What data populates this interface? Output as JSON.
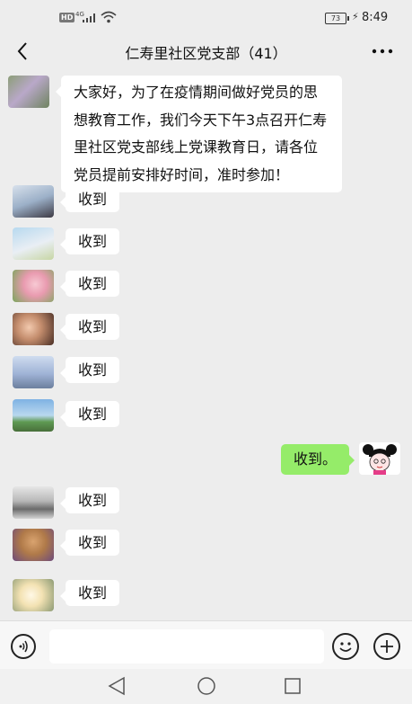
{
  "status_bar": {
    "hd": "HD",
    "network": "4G",
    "battery": "73",
    "time": "8:49"
  },
  "header": {
    "title": "仁寿里社区党支部（41）"
  },
  "messages": [
    {
      "text": "大家好，为了在疫情期间做好党员的思想教育工作，我们今天下午3点召开仁寿里社区党支部线上党课教育日，请各位党员提前安排好时间，准时参加！"
    },
    {
      "text": "收到"
    },
    {
      "text": "收到"
    },
    {
      "text": "收到"
    },
    {
      "text": "收到"
    },
    {
      "text": "收到"
    },
    {
      "text": "收到"
    },
    {
      "text": "收到。"
    },
    {
      "text": "收到"
    },
    {
      "text": "收到"
    },
    {
      "text": "收到"
    }
  ],
  "colors": {
    "background": "#ededed",
    "sent_bubble": "#95ec69",
    "received_bubble": "#ffffff"
  }
}
